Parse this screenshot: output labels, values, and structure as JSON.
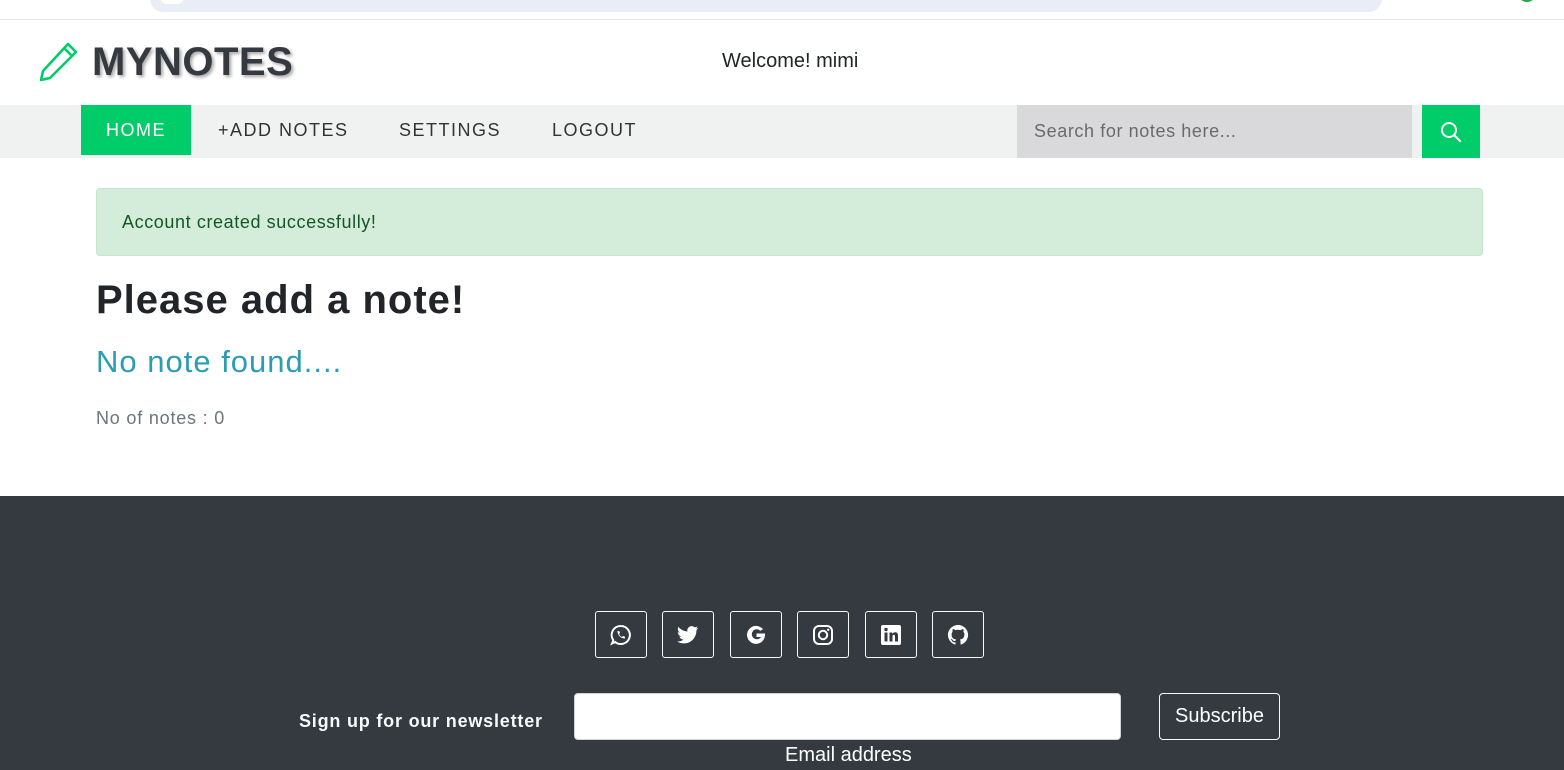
{
  "brand": {
    "name": "MYNOTES",
    "logo_icon": "pencil-icon",
    "color": "#00cc6a"
  },
  "header": {
    "welcome": "Welcome! mimi"
  },
  "nav": {
    "items": [
      {
        "label": "HOME",
        "active": true
      },
      {
        "label": "+ADD NOTES"
      },
      {
        "label": "SETTINGS"
      },
      {
        "label": "LOGOUT"
      }
    ]
  },
  "search": {
    "placeholder": "Search for notes here...",
    "value": "",
    "icon": "search-icon"
  },
  "alert": {
    "message": "Account created successfully!",
    "type": "success"
  },
  "main": {
    "heading": "Please add a note!",
    "empty_message": "No note found....",
    "count_text": "No of notes : 0"
  },
  "footer": {
    "social_icons": [
      "whatsapp-icon",
      "twitter-icon",
      "google-icon",
      "instagram-icon",
      "linkedin-icon",
      "github-icon"
    ],
    "newsletter_label": "Sign up for our newsletter",
    "email_value": "",
    "email_caption": "Email address",
    "subscribe_label": "Subscribe"
  },
  "colors": {
    "accent": "#00cc6a",
    "navbar_bg": "#f0f2f1",
    "footer_bg": "#343a40",
    "alert_bg": "#d4edda",
    "alert_text": "#155724",
    "empty_text": "#2a9db3"
  }
}
